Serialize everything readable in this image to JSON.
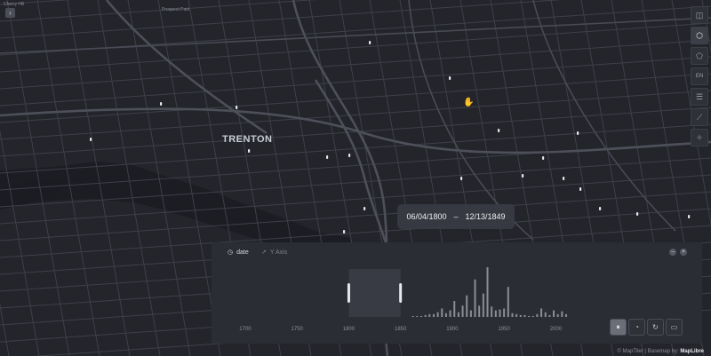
{
  "map": {
    "city_label": "TRENTON",
    "park_label": "Prospect Park",
    "corner_label": "Cherry Hill",
    "colors": {
      "background": "#24252b",
      "road": "#3e4049",
      "major_road": "#4a4c55",
      "water": "#1c1d22",
      "point": "#e6e8ec"
    }
  },
  "toolbar": {
    "items": [
      {
        "name": "layers-icon",
        "glyph": "◫"
      },
      {
        "name": "cube-icon",
        "glyph": "⬡"
      },
      {
        "name": "polygon-icon",
        "glyph": "⬠"
      },
      {
        "name": "language-toggle",
        "glyph": "EN"
      },
      {
        "name": "legend-icon",
        "glyph": "☰"
      },
      {
        "name": "ruler-icon",
        "glyph": "⟋"
      },
      {
        "name": "magic-icon",
        "glyph": "✧"
      }
    ]
  },
  "time_range": {
    "start": "06/04/1800",
    "separator": "–",
    "end": "12/13/1849"
  },
  "timeline": {
    "tab_date": "date",
    "tab_yaxis": "Y Axis",
    "axis_ticks": [
      "1700",
      "1750",
      "1800",
      "1850",
      "1900",
      "1950",
      "2000"
    ],
    "selection": [
      1800,
      1850
    ],
    "chart_data": {
      "type": "bar",
      "x_range": [
        1688,
        2022
      ],
      "years": [
        1862,
        1866,
        1870,
        1874,
        1878,
        1882,
        1886,
        1890,
        1894,
        1898,
        1902,
        1906,
        1910,
        1914,
        1918,
        1922,
        1926,
        1930,
        1934,
        1938,
        1942,
        1946,
        1950,
        1954,
        1958,
        1962,
        1966,
        1970,
        1974,
        1978,
        1982,
        1986,
        1990,
        1994,
        1998,
        2002,
        2006,
        2010
      ],
      "values": [
        1,
        1,
        1,
        2,
        3,
        3,
        5,
        9,
        4,
        7,
        17,
        5,
        12,
        23,
        7,
        40,
        12,
        25,
        53,
        11,
        7,
        8,
        9,
        32,
        4,
        3,
        2,
        2,
        1,
        1,
        3,
        9,
        5,
        2,
        7,
        3,
        6,
        3
      ]
    },
    "controls": [
      {
        "name": "pause-icon",
        "glyph": "⏸"
      },
      {
        "name": "speed-icon",
        "glyph": "◔"
      },
      {
        "name": "replay-icon",
        "glyph": "↻"
      },
      {
        "name": "export-video-icon",
        "glyph": "▭"
      }
    ]
  },
  "attribution": {
    "text": "© MapTiler | Basemap by:",
    "brand": "MapLibre"
  }
}
